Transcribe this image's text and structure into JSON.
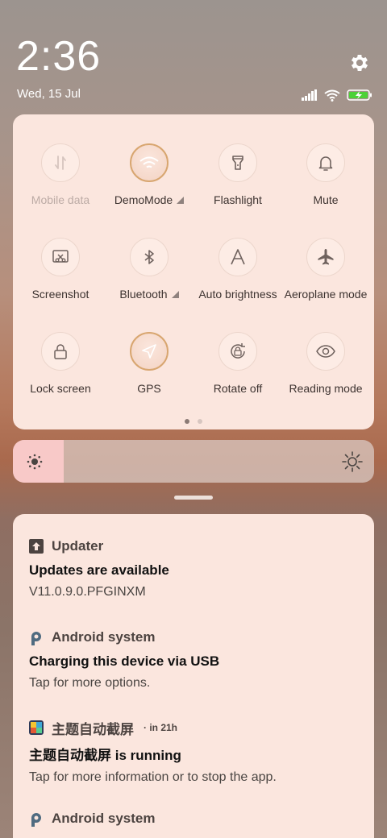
{
  "status": {
    "time": "2:36",
    "date": "Wed, 15 Jul",
    "icons": [
      "signal-icon",
      "wifi-icon",
      "battery-charging-icon"
    ],
    "settings_icon": "gear-icon"
  },
  "quick_settings": {
    "tiles": [
      {
        "label": "Mobile data",
        "icon": "mobile-data-icon",
        "state": "disabled"
      },
      {
        "label": "DemoMode",
        "icon": "wifi-icon",
        "state": "active",
        "has_menu": true
      },
      {
        "label": "Flashlight",
        "icon": "flashlight-icon",
        "state": "off"
      },
      {
        "label": "Mute",
        "icon": "bell-icon",
        "state": "off"
      },
      {
        "label": "Screenshot",
        "icon": "screenshot-icon",
        "state": "off"
      },
      {
        "label": "Bluetooth",
        "icon": "bluetooth-icon",
        "state": "off",
        "has_menu": true
      },
      {
        "label": "Auto brightness",
        "icon": "auto-brightness-icon",
        "state": "off"
      },
      {
        "label": "Aeroplane mode",
        "icon": "airplane-icon",
        "state": "off"
      },
      {
        "label": "Lock screen",
        "icon": "lock-icon",
        "state": "off"
      },
      {
        "label": "GPS",
        "icon": "location-icon",
        "state": "active"
      },
      {
        "label": "Rotate off",
        "icon": "rotate-lock-icon",
        "state": "off"
      },
      {
        "label": "Reading mode",
        "icon": "eye-icon",
        "state": "off"
      }
    ],
    "page_indicator": {
      "pages": 2,
      "current": 1
    }
  },
  "brightness": {
    "level": 0.14
  },
  "notifications": [
    {
      "app": "Updater",
      "icon": "updater-icon",
      "time": "",
      "title": "Updates are available",
      "text": "V11.0.9.0.PFGINXM"
    },
    {
      "app": "Android system",
      "icon": "android-system-icon",
      "time": "",
      "title": "Charging this device via USB",
      "text": "Tap for more options."
    },
    {
      "app": "主题自动截屏",
      "icon": "app-icon",
      "time": "· in 21h",
      "title": "主题自动截屏 is running",
      "text": "Tap for more information or to stop the app."
    },
    {
      "app": "Android system",
      "icon": "android-system-icon",
      "time": "",
      "title": "",
      "text": ""
    }
  ],
  "colors": {
    "panel": "#fbe6de",
    "active_ring": "#d8a670",
    "icon": "#6f625e",
    "brightness_fill": "#f8c9c8"
  }
}
